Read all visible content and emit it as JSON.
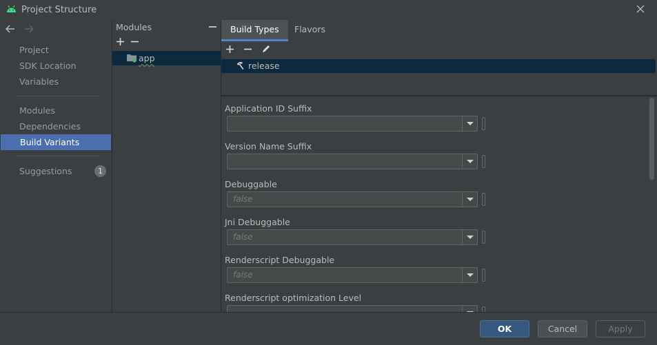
{
  "window": {
    "title": "Project Structure"
  },
  "nav": {
    "items": [
      {
        "label": "Project"
      },
      {
        "label": "SDK Location"
      },
      {
        "label": "Variables"
      },
      {
        "label": "Modules"
      },
      {
        "label": "Dependencies"
      },
      {
        "label": "Build Variants",
        "selected": true
      },
      {
        "label": "Suggestions",
        "badge": "1"
      }
    ]
  },
  "modules": {
    "header": "Modules",
    "items": [
      {
        "label": "app",
        "selected": true
      }
    ]
  },
  "tabs": [
    {
      "label": "Build Types",
      "active": true
    },
    {
      "label": "Flavors",
      "active": false
    }
  ],
  "build_types": [
    {
      "label": "release",
      "selected": true
    }
  ],
  "form": {
    "fields": [
      {
        "label": "Application ID Suffix",
        "value": ""
      },
      {
        "label": "Version Name Suffix",
        "value": ""
      },
      {
        "label": "Debuggable",
        "value": "false"
      },
      {
        "label": "Jni Debuggable",
        "value": "false"
      },
      {
        "label": "Renderscript Debuggable",
        "value": "false"
      },
      {
        "label": "Renderscript optimization Level",
        "value": ""
      }
    ]
  },
  "footer": {
    "ok": "OK",
    "cancel": "Cancel",
    "apply": "Apply"
  },
  "colors": {
    "selection": "#4b6eaf",
    "row_selection": "#0d293e",
    "ok_button": "#365880",
    "tab_underline": "#4a88c7"
  }
}
